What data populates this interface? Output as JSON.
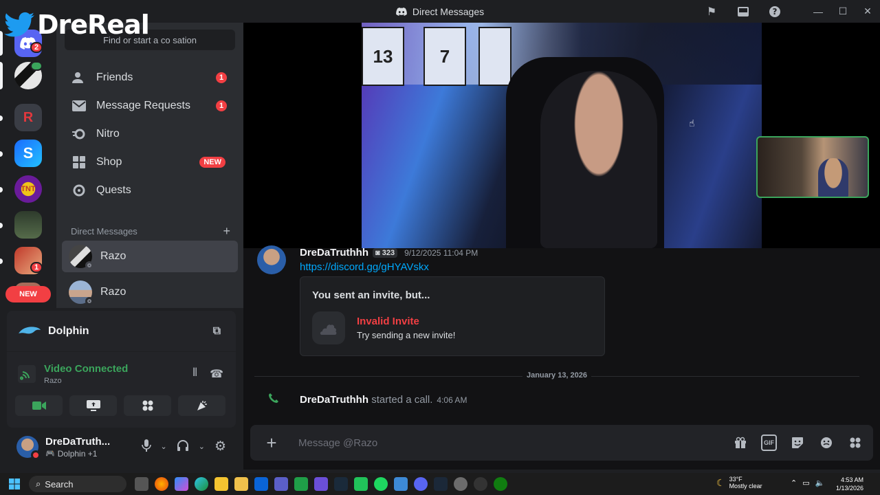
{
  "window": {
    "title": "Direct Messages"
  },
  "watermark": {
    "text": "DreReal"
  },
  "rail": {
    "dm_badge": "2",
    "server_badge": "1",
    "new_label": "NEW"
  },
  "sidebar": {
    "search_placeholder": "Find or start a co        sation",
    "nav": [
      {
        "label": "Friends",
        "badge": "1",
        "icon": "friends-icon"
      },
      {
        "label": "Message Requests",
        "badge": "1",
        "icon": "mail-icon"
      },
      {
        "label": "Nitro",
        "icon": "nitro-icon"
      },
      {
        "label": "Shop",
        "badge": "NEW",
        "icon": "shop-icon"
      },
      {
        "label": "Quests",
        "icon": "quests-icon"
      }
    ],
    "dm_header": "Direct Messages",
    "dms": [
      {
        "name": "Razo",
        "active": true
      },
      {
        "name": "Razo",
        "active": false
      }
    ]
  },
  "voice_panel": {
    "activity": "Dolphin",
    "status": "Video Connected",
    "channel": "Razo"
  },
  "user_panel": {
    "name": "DreDaTruth...",
    "activity": "Dolphin +1"
  },
  "message": {
    "author": "DreDaTruthhh",
    "tag": "323",
    "timestamp": "9/12/2025 11:04 PM",
    "link": "https://discord.gg/gHYAVskx",
    "invite_header": "You sent an invite, but...",
    "invite_title": "Invalid Invite",
    "invite_sub": "Try sending a new invite!"
  },
  "divider": {
    "date": "January 13, 2026"
  },
  "call": {
    "author": "DreDaTruthhh",
    "text": "started a call.",
    "time": "4:06 AM"
  },
  "composer": {
    "placeholder": "Message @Razo",
    "gif_label": "GIF"
  },
  "taskbar": {
    "search": "Search",
    "temp": "33°F",
    "weather": "Mostly clear",
    "time": "4:53 AM",
    "date": "1/13/2026"
  },
  "colors": {
    "accent_green": "#3ba55c",
    "alert_red": "#f23f43",
    "link_blue": "#00a8fc",
    "blurple": "#5865f2"
  }
}
